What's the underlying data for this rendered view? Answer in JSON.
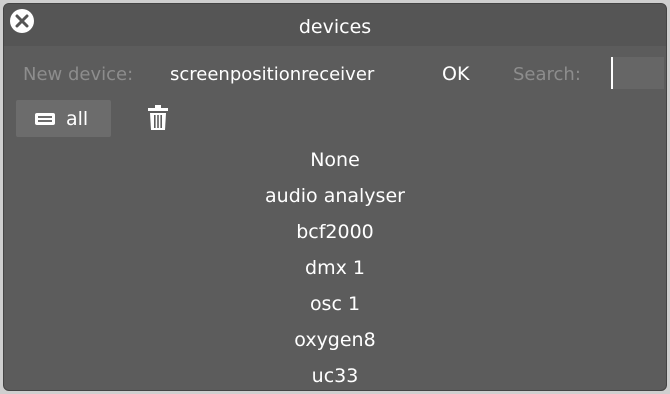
{
  "window": {
    "title": "devices"
  },
  "toolbar": {
    "new_device_label": "New device:",
    "new_device_value": "screenpositionreceiver",
    "ok_label": "OK",
    "search_label": "Search:",
    "search_value": ""
  },
  "filter": {
    "label": "all",
    "icon": "device-stack-icon"
  },
  "icons": {
    "close": "close-icon",
    "trash": "trash-icon"
  },
  "devices": [
    "None",
    "audio analyser",
    "bcf2000",
    "dmx 1",
    "osc 1",
    "oxygen8",
    "uc33"
  ],
  "colors": {
    "window_bg": "#5c5c5c",
    "titlebar_bg": "#555555",
    "label_gray": "#8d8d8d",
    "text": "#ffffff",
    "button_bg": "#6c6c6c"
  }
}
